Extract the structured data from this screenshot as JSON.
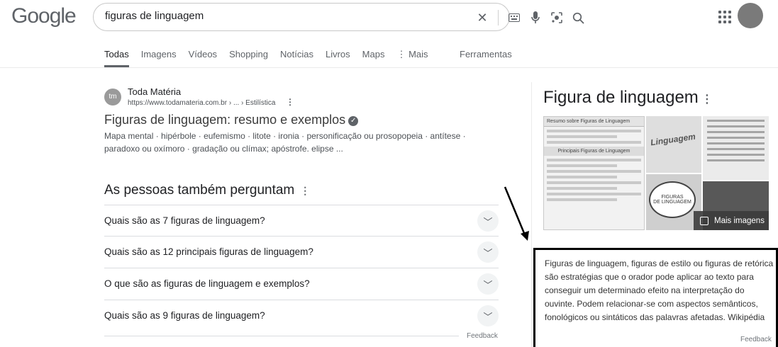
{
  "logo": "Google",
  "search": {
    "query": "figuras de linguagem",
    "icons": [
      "close-icon",
      "keyboard-icon",
      "microphone-icon",
      "camera-lens-icon",
      "search-icon"
    ]
  },
  "header_icons": [
    "apps-grid-icon",
    "avatar"
  ],
  "tabs": [
    {
      "label": "Todas",
      "active": true
    },
    {
      "label": "Imagens"
    },
    {
      "label": "Vídeos"
    },
    {
      "label": "Shopping"
    },
    {
      "label": "Notícias"
    },
    {
      "label": "Livros"
    },
    {
      "label": "Maps"
    },
    {
      "label": "⋮ Mais"
    }
  ],
  "tools_label": "Ferramentas",
  "result": {
    "site_name": "Toda Matéria",
    "url": "https://www.todamateria.com.br › ... › Estilística",
    "title": "Figuras de linguagem: resumo e exemplos",
    "snippet": "Mapa mental · hipérbole · eufemismo · litote · ironia · personificação ou prosopopeia · antítese · paradoxo ou oxímoro · gradação ou clímax; apóstrofe. elipse ..."
  },
  "paa": {
    "title": "As pessoas também perguntam",
    "questions": [
      "Quais são as 7 figuras de linguagem?",
      "Quais são as 12 principais figuras de linguagem?",
      "O que são as figuras de linguagem e exemplos?",
      "Quais são as 9 figuras de linguagem?"
    ],
    "feedback": "Feedback"
  },
  "knowledge_panel": {
    "title": "Figura de linguagem",
    "images": {
      "a_header": "Resumo sobre Figuras de Linguagem",
      "a_sub": "Principais Figuras de Linguagem",
      "b_word": "Linguagem",
      "c_text_1": "FIGURAS",
      "c_text_2": "DE LINGUAGEM"
    },
    "more_images": "Mais imagens",
    "description": "Figuras de linguagem, figuras de estilo ou figuras de retórica são estratégias que o orador pode aplicar ao texto para conseguir um determinado efeito na interpretação do ouvinte. Podem relacionar-se com aspectos semânticos, fonológicos ou sintáticos das palavras afetadas.",
    "source": "Wikipédia",
    "feedback": "Feedback"
  }
}
